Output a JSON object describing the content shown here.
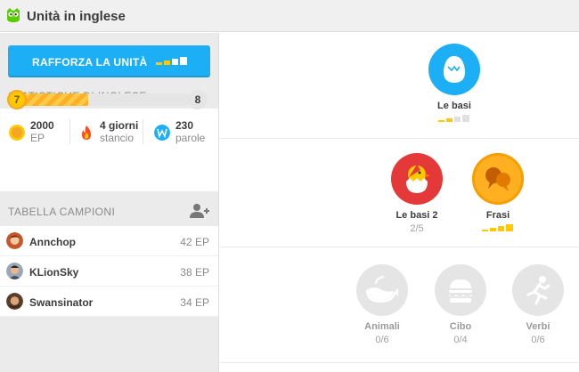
{
  "header": {
    "title": "Unità in inglese",
    "logo_icon": "duolingo-owl-icon"
  },
  "left": {
    "strengthen_button": {
      "label": "RAFFORZA LA UNITÀ",
      "icon": "strength-bars-icon",
      "strength_level": 0.5
    },
    "stats_title": "STATISTICHE DI INGLESE",
    "level": {
      "current": "7",
      "next": "8",
      "progress": 0.4
    },
    "stats": {
      "xp": {
        "value": "2000",
        "unit": "EP",
        "icon": "xp-coin-icon"
      },
      "streak": {
        "value": "4 giorni",
        "unit": "stancio",
        "icon": "flame-icon"
      },
      "words": {
        "value": "230",
        "unit": "parole",
        "icon": "words-w-icon"
      }
    },
    "leaderboard_title": "TABELLA CAMPIONI",
    "add_friend_icon": "add-friend-icon",
    "leaderboard": [
      {
        "name": "Annchop",
        "xp": "42 EP",
        "avatar": "avatar-icon"
      },
      {
        "name": "KLionSky",
        "xp": "38 EP",
        "avatar": "avatar-icon"
      },
      {
        "name": "Swansinator",
        "xp": "34 EP",
        "avatar": "avatar-icon"
      }
    ]
  },
  "colors": {
    "accent": "#1caff6",
    "gold": "#ffc800",
    "red": "#e53838",
    "locked": "#e5e5e5"
  },
  "skills": {
    "basics1": {
      "name": "Le basi",
      "icon": "egg-icon",
      "strength": 0.5
    },
    "basics2": {
      "name": "Le basi 2",
      "progress": "2/5",
      "icon": "chick-in-egg-icon"
    },
    "phrases": {
      "name": "Frasi",
      "icon": "speech-bubbles-icon",
      "strength": 1.0
    },
    "animals": {
      "name": "Animali",
      "progress": "0/6",
      "icon": "whale-icon"
    },
    "food": {
      "name": "Cibo",
      "progress": "0/4",
      "icon": "burger-icon"
    },
    "verbs": {
      "name": "Verbi",
      "progress": "0/6",
      "icon": "running-man-icon"
    }
  }
}
